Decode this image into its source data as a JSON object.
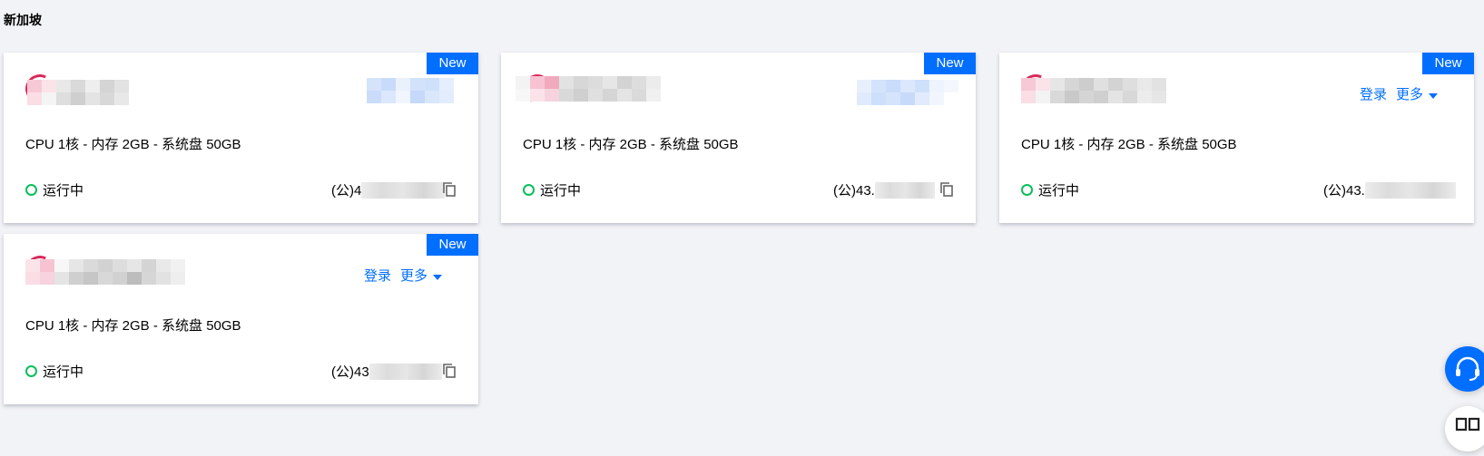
{
  "region": {
    "title": "新加坡"
  },
  "cards": [
    {
      "badge": "New",
      "spec": "CPU 1核 - 内存 2GB - 系统盘 50GB",
      "status": "运行中",
      "ip_prefix": "(公)4",
      "login_label": "",
      "more_label": ""
    },
    {
      "badge": "New",
      "spec": "CPU 1核 - 内存 2GB - 系统盘 50GB",
      "status": "运行中",
      "ip_prefix": "(公)43.",
      "login_label": "",
      "more_label": ""
    },
    {
      "badge": "New",
      "spec": "CPU 1核 - 内存 2GB - 系统盘 50GB",
      "status": "运行中",
      "ip_prefix": "(公)43.",
      "login_label": "登录",
      "more_label": "更多"
    },
    {
      "badge": "New",
      "spec": "CPU 1核 - 内存 2GB - 系统盘 50GB",
      "status": "运行中",
      "ip_prefix": "(公)43",
      "login_label": "登录",
      "more_label": "更多"
    }
  ],
  "colors": {
    "accent": "#006eff",
    "status_running": "#0abf5b",
    "logo": "#d8295a",
    "background": "#f2f3f7"
  },
  "icons": {
    "copy": "copy-icon",
    "support": "headset-icon",
    "docs": "book-icon",
    "more_caret": "caret-down-icon"
  }
}
